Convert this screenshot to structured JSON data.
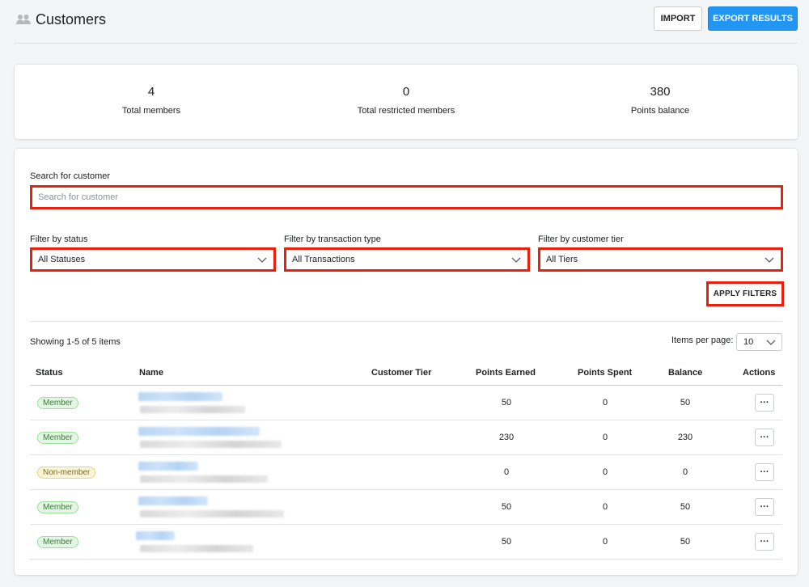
{
  "header": {
    "title": "Customers",
    "icon": "people-icon",
    "import_label": "IMPORT",
    "export_label": "EXPORT RESULTS"
  },
  "stats": [
    {
      "value": "4",
      "label": "Total members"
    },
    {
      "value": "0",
      "label": "Total restricted members"
    },
    {
      "value": "380",
      "label": "Points balance"
    }
  ],
  "search": {
    "label": "Search for customer",
    "placeholder": "Search for customer"
  },
  "filters": {
    "status": {
      "label": "Filter by status",
      "value": "All Statuses"
    },
    "transaction": {
      "label": "Filter by transaction type",
      "value": "All Transactions"
    },
    "tier": {
      "label": "Filter by customer tier",
      "value": "All Tiers"
    },
    "apply_label": "APPLY FILTERS"
  },
  "pagination": {
    "showing": "Showing 1-5 of 5 items",
    "items_per_page_label": "Items per page:",
    "items_per_page": "10"
  },
  "table": {
    "columns": [
      "Status",
      "Name",
      "Customer Tier",
      "Points Earned",
      "Points Spent",
      "Balance",
      "Actions"
    ],
    "rows": [
      {
        "status": "Member",
        "earned": "50",
        "spent": "0",
        "balance": "50",
        "action": "···"
      },
      {
        "status": "Member",
        "earned": "230",
        "spent": "0",
        "balance": "230",
        "action": "···"
      },
      {
        "status": "Non-member",
        "earned": "0",
        "spent": "0",
        "balance": "0",
        "action": "···"
      },
      {
        "status": "Member",
        "earned": "50",
        "spent": "0",
        "balance": "50",
        "action": "···"
      },
      {
        "status": "Member",
        "earned": "50",
        "spent": "0",
        "balance": "50",
        "action": "···"
      }
    ]
  },
  "colors": {
    "accent": "#2196f3",
    "highlight": "#e8210f",
    "member_badge": "#e3f6e3",
    "nonmember_badge": "#fbf5d8"
  }
}
